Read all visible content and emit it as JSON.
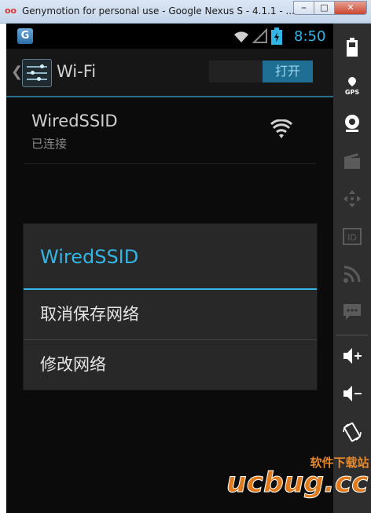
{
  "window": {
    "title": "Genymotion for personal use - Google Nexus S - 4.1.1 - ...",
    "icon_text": "oo",
    "minimize_icon": "minimize-icon",
    "maximize_icon": "maximize-icon",
    "close_icon": "close-icon"
  },
  "statusbar": {
    "time": "8:50",
    "app_icon_letter": "G",
    "icons": [
      "wifi-signal-icon",
      "cell-signal-icon",
      "battery-charging-icon"
    ]
  },
  "actionbar": {
    "title": "Wi-Fi",
    "toggle_label": "打开",
    "icon": "settings-sliders-icon"
  },
  "wifi_list": [
    {
      "ssid": "WiredSSID",
      "status": "已连接"
    }
  ],
  "dialog": {
    "title": "WiredSSID",
    "items": [
      "取消保存网络",
      "修改网络"
    ]
  },
  "side_panel": {
    "buttons": [
      {
        "icon": "battery-icon",
        "enabled": true
      },
      {
        "icon": "gps-icon",
        "label": "GPS",
        "enabled": true
      },
      {
        "icon": "webcam-icon",
        "enabled": true
      },
      {
        "icon": "clapperboard-icon",
        "enabled": false
      },
      {
        "icon": "dpad-icon",
        "enabled": false
      },
      {
        "icon": "id-icon",
        "label": "ID",
        "enabled": false
      },
      {
        "icon": "rss-icon",
        "enabled": false
      },
      {
        "icon": "sms-icon",
        "enabled": false
      },
      {
        "icon": "volume-up-icon",
        "enabled": true
      },
      {
        "icon": "volume-down-icon",
        "enabled": true
      },
      {
        "icon": "rotate-icon",
        "enabled": true
      }
    ]
  },
  "watermark": {
    "text": "ucbug.cc",
    "subtext": "软件下载站"
  },
  "colors": {
    "accent": "#33b5e5",
    "dialog_bg": "#282828",
    "screen_bg": "#0b0b0b",
    "panel_bg": "#2e2e2e"
  }
}
